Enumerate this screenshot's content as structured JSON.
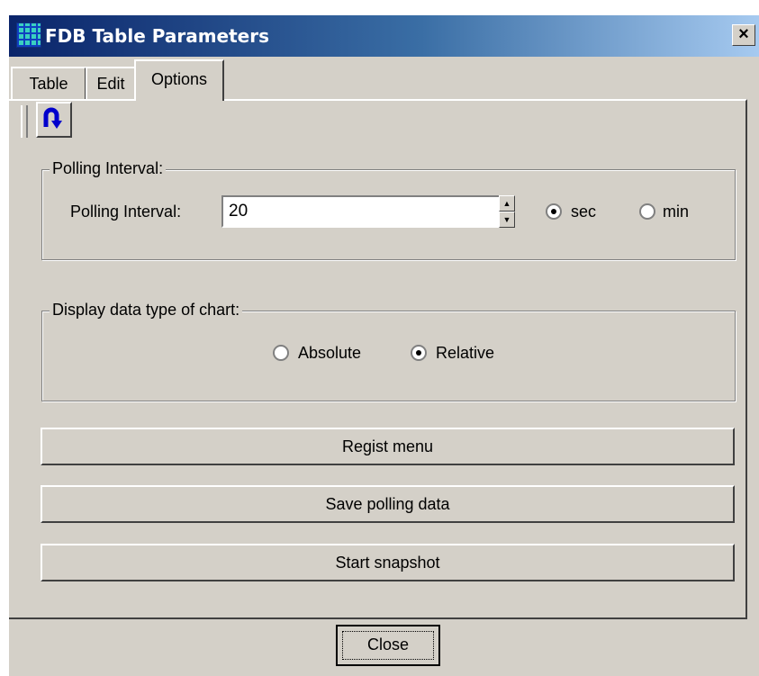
{
  "window": {
    "title": "FDB Table Parameters",
    "close_glyph": "×"
  },
  "tabs": [
    {
      "label": "Table",
      "active": false
    },
    {
      "label": "Edit",
      "active": false
    },
    {
      "label": "Options",
      "active": true
    }
  ],
  "toolbar": {
    "refresh_icon": "refresh-arrow-icon"
  },
  "polling": {
    "group_label": "Polling Interval:",
    "field_label": "Polling Interval:",
    "value": "20",
    "unit_options": [
      {
        "label": "sec",
        "selected": true
      },
      {
        "label": "min",
        "selected": false
      }
    ]
  },
  "display": {
    "group_label": "Display data type of chart:",
    "options": [
      {
        "label": "Absolute",
        "selected": false
      },
      {
        "label": "Relative",
        "selected": true
      }
    ]
  },
  "buttons": {
    "regist_menu": "Regist menu",
    "save_polling": "Save polling data",
    "start_snapshot": "Start snapshot",
    "close": "Close"
  },
  "colors": {
    "face": "#d4d0c8",
    "title_start": "#0a246a",
    "title_end": "#a6caf0",
    "icon_blue": "#0000cc"
  }
}
